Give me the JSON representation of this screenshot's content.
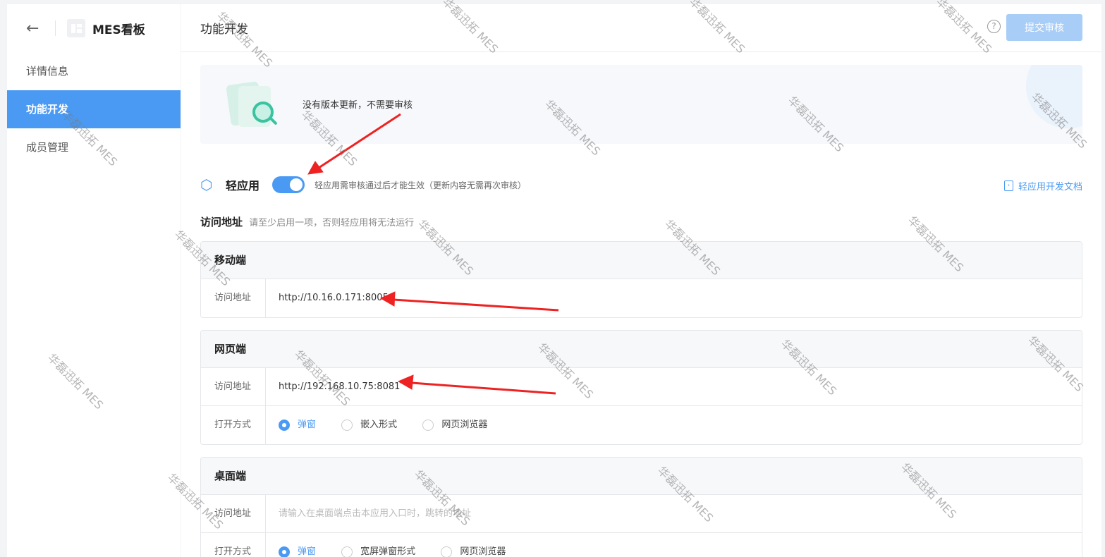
{
  "sidebar": {
    "back_icon": "←",
    "app_name": "MES看板",
    "items": [
      {
        "label": "详情信息",
        "active": false
      },
      {
        "label": "功能开发",
        "active": true
      },
      {
        "label": "成员管理",
        "active": false
      }
    ]
  },
  "header": {
    "title": "功能开发",
    "help_icon": "?",
    "submit_label": "提交审核"
  },
  "banner": {
    "text": "没有版本更新，不需要审核"
  },
  "light_app": {
    "title": "轻应用",
    "enabled": true,
    "hint": "轻应用需审核通过后才能生效（更新内容无需再次审核）",
    "doc_link": "轻应用开发文档"
  },
  "access": {
    "title": "访问地址",
    "hint": "请至少启用一项，否则轻应用将无法运行"
  },
  "mobile": {
    "title": "移动端",
    "addr_label": "访问地址",
    "addr_value": "http://10.16.0.171:8005"
  },
  "web": {
    "title": "网页端",
    "addr_label": "访问地址",
    "addr_value": "http://192.168.10.75:8081",
    "open_label": "打开方式",
    "options": [
      "弹窗",
      "嵌入形式",
      "网页浏览器"
    ],
    "selected": "弹窗"
  },
  "desktop": {
    "title": "桌面端",
    "addr_label": "访问地址",
    "addr_placeholder": "请输入在桌面端点击本应用入口时，跳转的地址",
    "open_label": "打开方式",
    "options": [
      "弹窗",
      "宽屏弹窗形式",
      "网页浏览器"
    ],
    "selected": "弹窗"
  },
  "watermark": "华磊迅拓 MES",
  "colors": {
    "accent": "#4a9af4",
    "arrow": "#ee2222"
  }
}
